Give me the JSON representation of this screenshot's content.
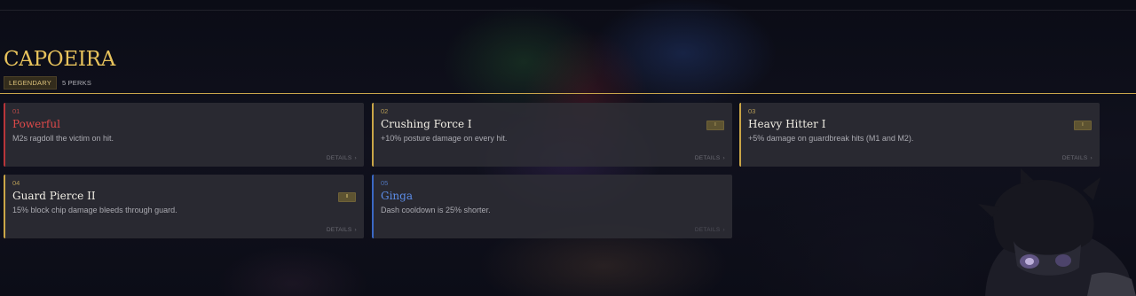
{
  "discipline": {
    "title": "CAPOEIRA",
    "rarity": "LEGENDARY",
    "perk_count": "5 PERKS"
  },
  "perks": [
    {
      "number": "01",
      "name": "Powerful",
      "description": "M2s ragdoll the victim on hit.",
      "tier": "",
      "details_label": "DETAILS",
      "accent": "#b8353a"
    },
    {
      "number": "02",
      "name": "Crushing Force I",
      "description": "+10% posture damage on every hit.",
      "tier": "I",
      "details_label": "DETAILS",
      "accent": "#caa647"
    },
    {
      "number": "03",
      "name": "Heavy Hitter I",
      "description": "+5% damage on guardbreak hits (M1 and M2).",
      "tier": "I",
      "details_label": "DETAILS",
      "accent": "#caa647"
    },
    {
      "number": "04",
      "name": "Guard Pierce II",
      "description": "15% block chip damage bleeds through guard.",
      "tier": "II",
      "details_label": "DETAILS",
      "accent": "#caa647"
    },
    {
      "number": "05",
      "name": "Ginga",
      "description": "Dash cooldown is 25% shorter.",
      "tier": "",
      "details_label": "DETAILS",
      "accent": "#3a68c4"
    }
  ],
  "icons": {
    "details_chevron": "chevron-right-icon"
  }
}
